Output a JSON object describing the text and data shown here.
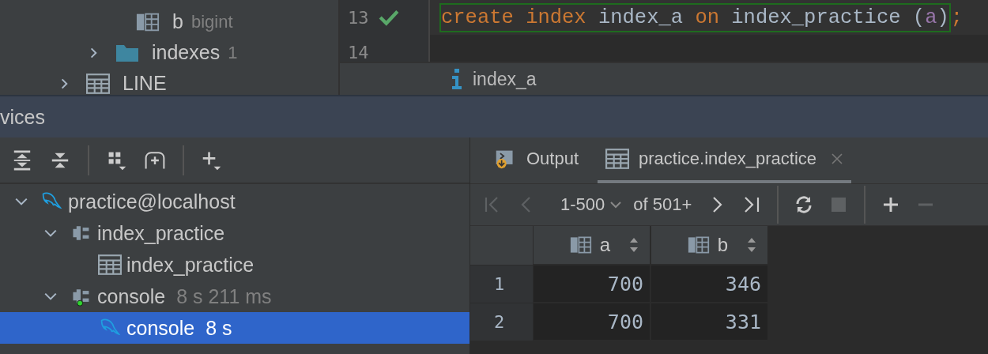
{
  "schema_tree": [
    {
      "kind": "column",
      "label": "b",
      "type": "bigint"
    },
    {
      "kind": "folder",
      "label": "indexes",
      "count": "1",
      "expanded": false
    },
    {
      "kind": "table",
      "label": "LINE",
      "expanded": false
    }
  ],
  "editor": {
    "lines": [
      {
        "number": "13",
        "executed": true,
        "tokens": [
          {
            "text": "create ",
            "kind": "keyword"
          },
          {
            "text": "index ",
            "kind": "keyword"
          },
          {
            "text": "index_a ",
            "kind": "identifier"
          },
          {
            "text": "on ",
            "kind": "keyword"
          },
          {
            "text": "index_practice (",
            "kind": "identifier"
          },
          {
            "text": "a",
            "kind": "param"
          },
          {
            "text": ")",
            "kind": "identifier"
          }
        ],
        "terminator": ";"
      },
      {
        "number": "14"
      }
    ]
  },
  "completion_popup": {
    "items": [
      {
        "label": "index_a"
      }
    ]
  },
  "services_panel": {
    "title": "vices"
  },
  "services_tree": [
    {
      "label": "practice@localhost",
      "kind": "datasource",
      "expanded": true,
      "selected": false,
      "children": [
        {
          "label": "index_practice",
          "kind": "session",
          "expanded": true,
          "selected": false,
          "active": false,
          "children": [
            {
              "label": "index_practice",
              "kind": "table",
              "selected": false
            }
          ]
        },
        {
          "label": "console",
          "kind": "session",
          "detail": "8 s 211 ms",
          "expanded": true,
          "selected": false,
          "active": true,
          "children": [
            {
              "label": "console",
              "kind": "console",
              "detail": "8 s",
              "selected": true
            }
          ]
        }
      ]
    }
  ],
  "result_tabs": [
    {
      "label": "Output",
      "kind": "output",
      "selected": false
    },
    {
      "label": "practice.index_practice",
      "kind": "table",
      "selected": true,
      "closable": true
    }
  ],
  "pager": {
    "range": "1-500",
    "total": "of 501+"
  },
  "grid": {
    "columns": [
      "a",
      "b"
    ],
    "rows": [
      {
        "number": "1",
        "cells": [
          "700",
          "346"
        ]
      },
      {
        "number": "2",
        "cells": [
          "700",
          "331"
        ]
      }
    ]
  }
}
